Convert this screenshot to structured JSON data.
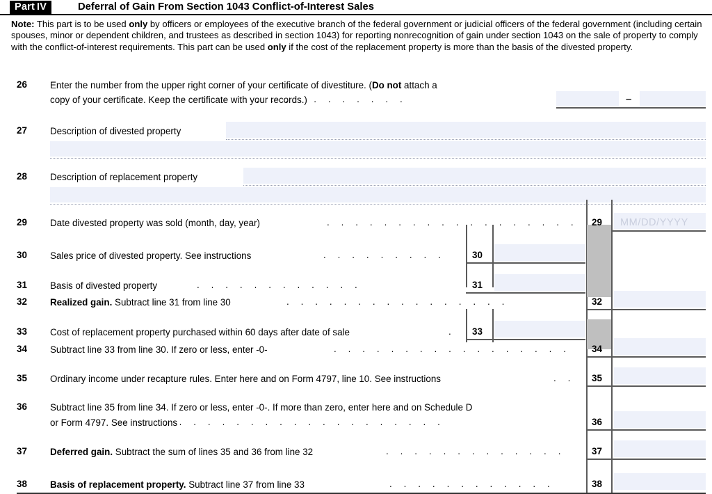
{
  "header": {
    "part_label": "Part",
    "part_number": "IV",
    "title": "Deferral of Gain From Section 1043 Conflict-of-Interest Sales"
  },
  "note": {
    "label": "Note:",
    "text_1": " This part is to be used ",
    "bold_1": "only",
    "text_2": " by officers or employees of the executive branch of the federal government or judicial officers of the federal government (including certain spouses, minor or dependent children, and trustees as described in section 1043) for reporting nonrecognition of gain under section 1043 on the sale of property to comply with the conflict-of-interest requirements. This part can be used ",
    "bold_2": "only",
    "text_3": " if the cost of the replacement property is more than the basis of the divested property."
  },
  "lines": {
    "l26": {
      "num": "26",
      "text_a": "Enter the number from the upper right corner of your certificate of divestiture. (",
      "bold_a": "Do not",
      "text_b": " attach a",
      "text_c": "copy of your certificate. Keep the certificate with your records.)",
      "separator": "–",
      "value_left": "",
      "value_right": ""
    },
    "l27": {
      "num": "27",
      "text": "Description of divested property",
      "value": ""
    },
    "l28": {
      "num": "28",
      "text": "Description of replacement property",
      "value": ""
    },
    "l29": {
      "num": "29",
      "text": "Date divested property was sold (month, day, year)",
      "box": "29",
      "placeholder": "MM/DD/YYYY",
      "value": ""
    },
    "l30": {
      "num": "30",
      "text": "Sales price of divested property. See instructions",
      "box": "30",
      "value": ""
    },
    "l31": {
      "num": "31",
      "text": "Basis of divested property",
      "box": "31",
      "value": ""
    },
    "l32": {
      "num": "32",
      "bold": "Realized gain.",
      "text": " Subtract line 31 from line 30",
      "box": "32",
      "value": ""
    },
    "l33": {
      "num": "33",
      "text": "Cost of replacement property purchased within 60 days after date of sale",
      "box": "33",
      "value": ""
    },
    "l34": {
      "num": "34",
      "text": "Subtract line 33 from line 30. If zero or less, enter -0-",
      "box": "34",
      "value": ""
    },
    "l35": {
      "num": "35",
      "text": "Ordinary income under recapture rules. Enter here and on Form 4797, line 10. See instructions",
      "box": "35",
      "value": ""
    },
    "l36": {
      "num": "36",
      "text_a": "Subtract line 35 from line 34. If zero or less, enter -0-. If more than zero, enter here and on Schedule D",
      "text_b": "or Form 4797. See instructions",
      "box": "36",
      "value": ""
    },
    "l37": {
      "num": "37",
      "bold": "Deferred gain.",
      "text": " Subtract the sum of lines 35 and 36 from line 32",
      "box": "37",
      "value": ""
    },
    "l38": {
      "num": "38",
      "bold": "Basis of replacement property.",
      "text": " Subtract line 37 from line 33",
      "box": "38",
      "value": ""
    }
  },
  "leaders": {
    "d26": ". . . . . . . . . . . .",
    "d29": ". . . . . . . . . . . . . . . . . .",
    "d30": ". . . . . . . . .",
    "d31": ". . . . . . . . . . . .",
    "d32": ". . . . . . . . . . . . . . . .",
    "d33": ".",
    "d34": ". . . . . . . . . . . . . . . . .",
    "d35": ". .",
    "d36": ". . . . . . . . . . . . . . . . . . . .",
    "d37": ". . . . . . . . . . . . .",
    "d38": ". . . . . . . . . . . ."
  },
  "colors": {
    "field_fill": "#eef1fa",
    "shaded_block": "#bfbfbf",
    "rule": "#5a5a5a",
    "placeholder_text": "#c9cede"
  }
}
